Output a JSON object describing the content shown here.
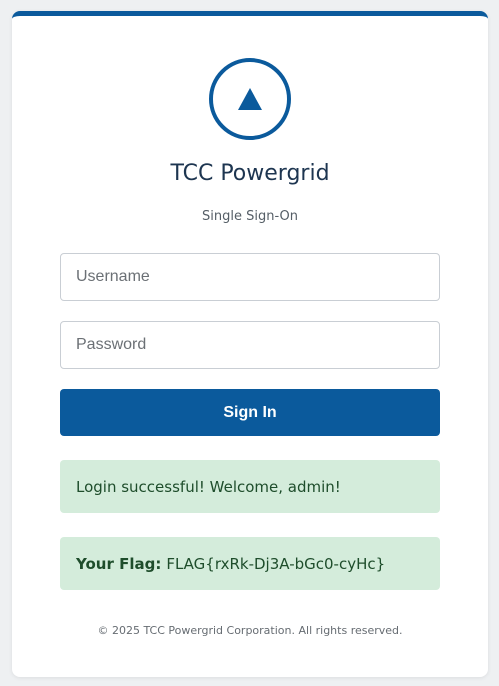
{
  "app": {
    "title": "TCC Powergrid",
    "subtitle": "Single Sign-On",
    "brand_color": "#0b5a9c",
    "logo_icon": "triangle-up-icon"
  },
  "form": {
    "username_placeholder": "Username",
    "password_placeholder": "Password",
    "signin_label": "Sign In"
  },
  "alerts": {
    "success_message": "Login successful! Welcome, admin!",
    "flag_label": "Your Flag:",
    "flag_value": "FLAG{rxRk-Dj3A-bGc0-cyHc}",
    "success_color": "#d4ecdb"
  },
  "footer": {
    "text": "© 2025 TCC Powergrid Corporation. All rights reserved."
  }
}
